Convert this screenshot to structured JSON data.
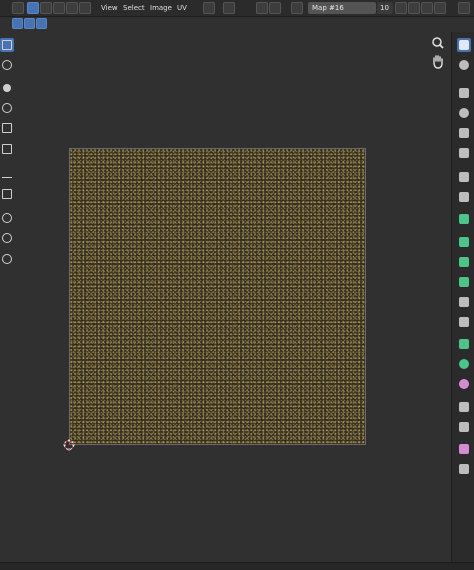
{
  "header": {
    "editor_type_icon": "uv-editor-icon",
    "menus": [
      "View",
      "Select",
      "Image",
      "UV"
    ],
    "image_name": "Map #16",
    "users_count": "10"
  },
  "colors": {
    "accent": "#4772b3",
    "background": "#303030",
    "header": "#2b2b2b",
    "texture_base": "#3a3324",
    "texture_speckle": "#cfb660"
  },
  "left_toolbar": {
    "tools": [
      "select-box-icon",
      "cursor-icon",
      "move-icon",
      "rotate-icon",
      "scale-icon",
      "transform-icon",
      "annotate-icon",
      "box-icon",
      "grab-icon",
      "relax-icon",
      "pinch-icon"
    ]
  },
  "right_rail": {
    "tools": [
      "select-icon",
      "cursor-icon",
      "move-icon",
      "rotate-icon",
      "scale-icon",
      "transform-icon",
      "annotate-icon",
      "measure-icon",
      "add-cube-icon",
      "extrude-icon",
      "inset-icon",
      "bevel-icon",
      "loop-cut-icon",
      "knife-icon",
      "poly-build-icon",
      "spin-icon",
      "smooth-icon",
      "edge-slide-icon",
      "shrink-icon",
      "shear-icon",
      "rip-icon"
    ]
  }
}
